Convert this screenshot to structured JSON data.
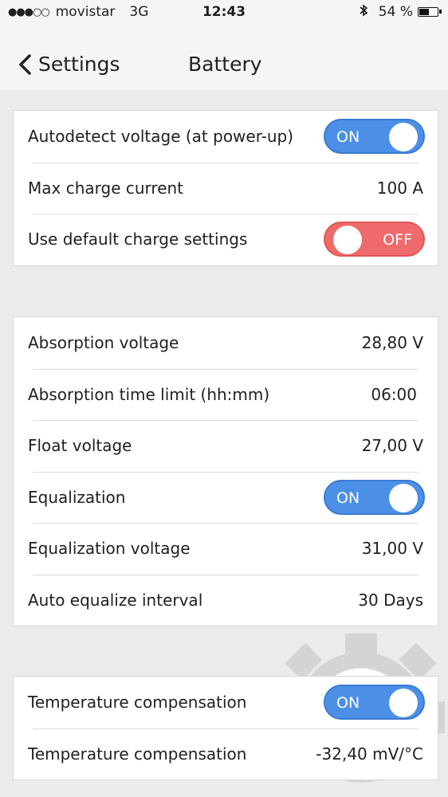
{
  "status_bar": {
    "signal": "●●●○○",
    "carrier": "movistar",
    "network": "3G",
    "time": "12:43",
    "battery_percent": "54 %"
  },
  "nav": {
    "back_label": "Settings",
    "title": "Battery"
  },
  "groups": [
    {
      "rows": [
        {
          "label": "Autodetect voltage (at power-up)",
          "toggle": "ON"
        },
        {
          "label": "Max charge current",
          "value": "100 A"
        },
        {
          "label": "Use default charge settings",
          "toggle": "OFF"
        }
      ]
    },
    {
      "rows": [
        {
          "label": "Absorption voltage",
          "value": "28,80 V"
        },
        {
          "label": "Absorption time limit (hh:mm)",
          "value": "06:00"
        },
        {
          "label": "Float voltage",
          "value": "27,00 V"
        },
        {
          "label": "Equalization",
          "toggle": "ON"
        },
        {
          "label": "Equalization voltage",
          "value": "31,00 V"
        },
        {
          "label": "Auto equalize interval",
          "value": "30 Days"
        }
      ]
    },
    {
      "rows": [
        {
          "label": "Temperature compensation",
          "toggle": "ON"
        },
        {
          "label": "Temperature compensation",
          "value": "-32,40 mV/°C"
        }
      ]
    }
  ],
  "colors": {
    "toggle_on": "#4b90e6",
    "toggle_off": "#ef6a6a",
    "background": "#ebebe9"
  }
}
